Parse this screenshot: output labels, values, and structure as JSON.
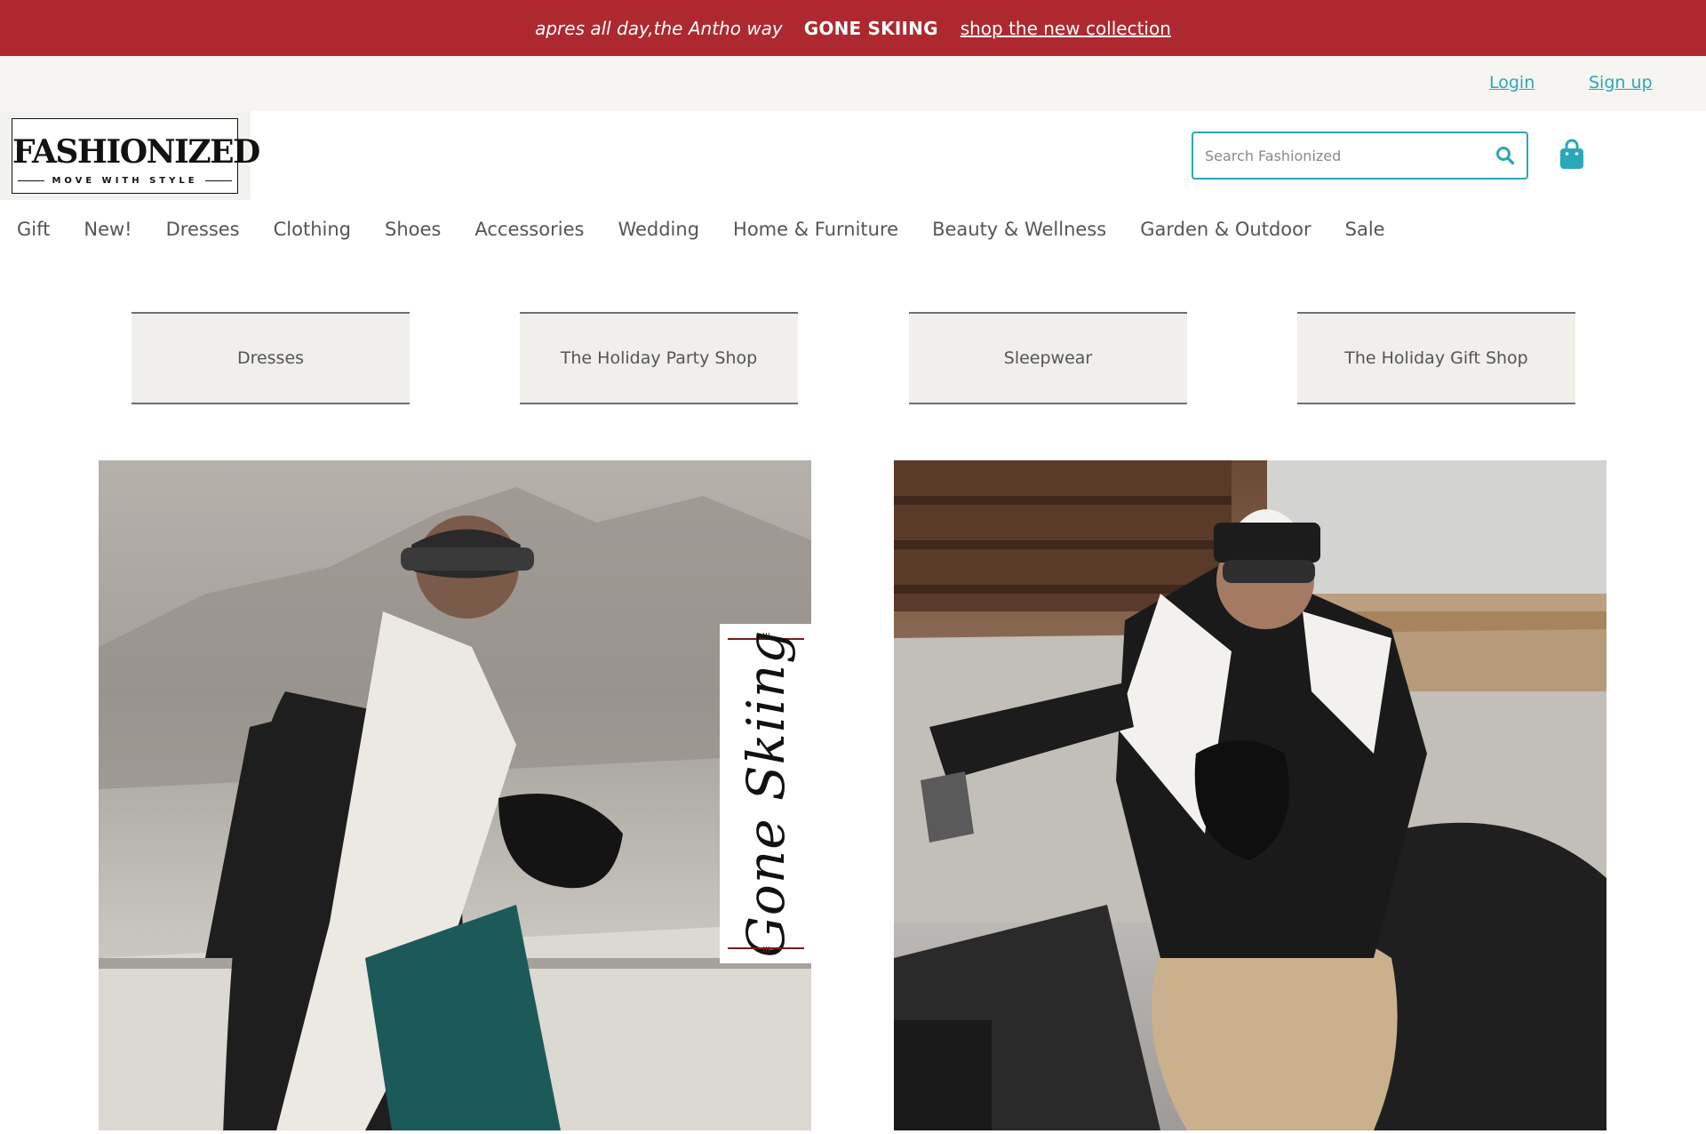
{
  "promo": {
    "tagline": "apres all day,the Antho way",
    "headline": "GONE SKIING",
    "cta": "shop the new collection"
  },
  "account": {
    "login": "Login",
    "signup": "Sign up"
  },
  "logo": {
    "title": "FASHIONIZED",
    "subtitle": "MOVE WITH STYLE"
  },
  "search": {
    "placeholder": "Search Fashionized",
    "icon": "search-icon"
  },
  "cart": {
    "icon": "shopping-bag-icon"
  },
  "nav": {
    "items": [
      "Gift",
      "New!",
      "Dresses",
      "Clothing",
      "Shoes",
      "Accessories",
      "Wedding",
      "Home & Furniture",
      "Beauty & Wellness",
      "Garden & Outdoor",
      "Sale"
    ]
  },
  "tiles": [
    "Dresses",
    "The Holiday Party Shop",
    "Sleepwear",
    "The Holiday Gift Shop"
  ],
  "hero": {
    "badge_text": "Gone Skiing"
  },
  "colors": {
    "promo_bg": "#ad292f",
    "accent": "#2aa7b8",
    "account_bg": "#f6f5f1",
    "tile_bg": "#f1efec"
  }
}
